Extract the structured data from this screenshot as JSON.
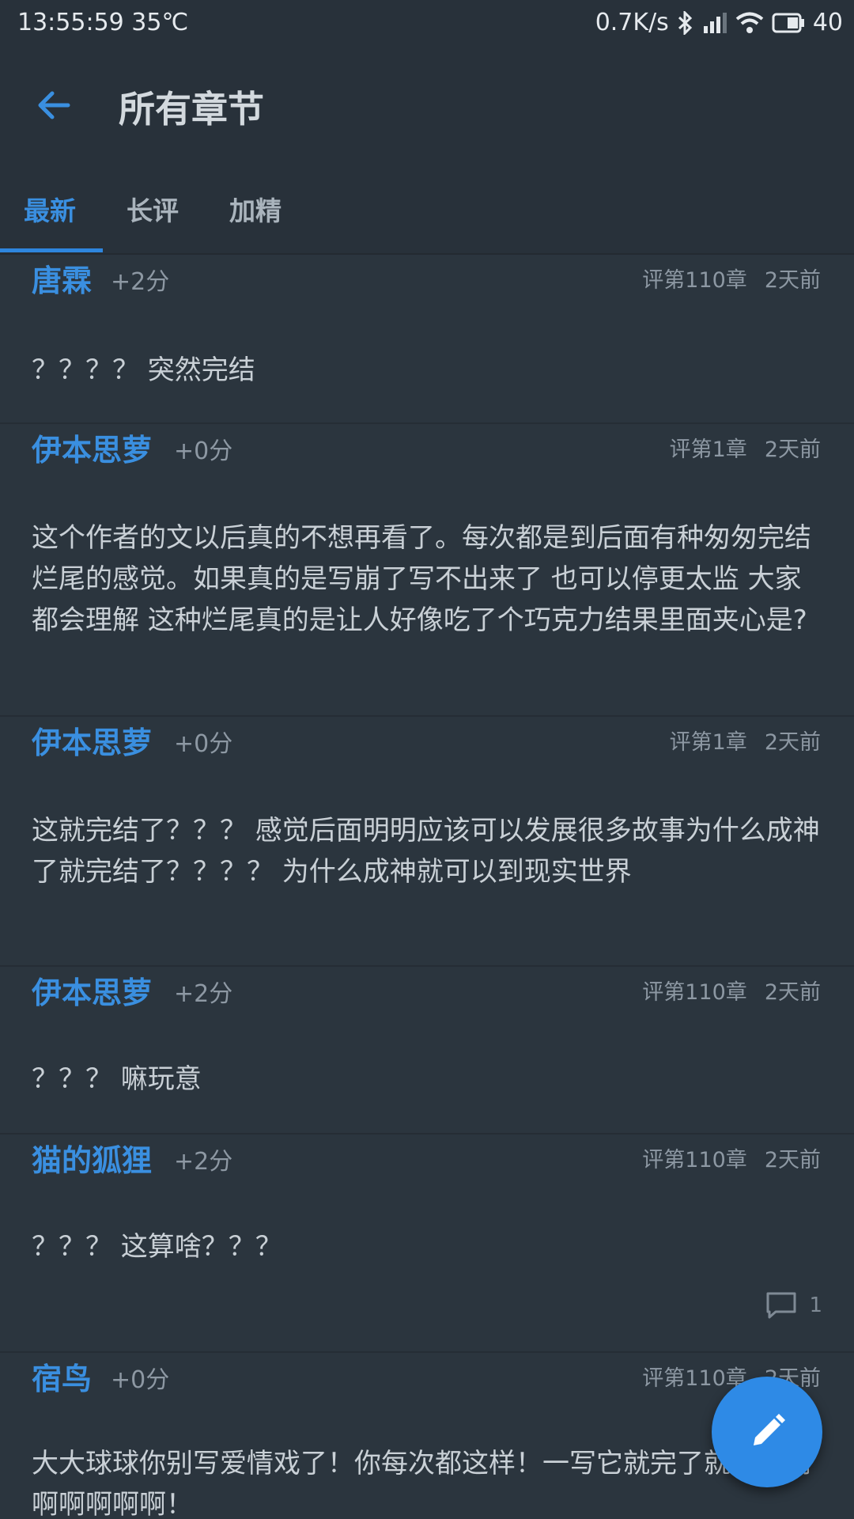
{
  "status": {
    "time_temp": "13:55:59 35℃",
    "net_speed": "0.7K/s",
    "battery": "40"
  },
  "appbar": {
    "title": "所有章节"
  },
  "tabs": [
    {
      "label": "最新",
      "active": true
    },
    {
      "label": "长评",
      "active": false
    },
    {
      "label": "加精",
      "active": false
    }
  ],
  "comments": [
    {
      "author": "唐霖",
      "score": "+2分",
      "chapter": "评第110章",
      "time": "2天前",
      "content": "？？？？ 突然完结"
    },
    {
      "author": "伊本思萝",
      "score": "+0分",
      "chapter": "评第1章",
      "time": "2天前",
      "content": "这个作者的文以后真的不想再看了。每次都是到后面有种匆匆完结烂尾的感觉。如果真的是写崩了写不出来了 也可以停更太监 大家都会理解 这种烂尾真的是让人好像吃了个巧克力结果里面夹心是?"
    },
    {
      "author": "伊本思萝",
      "score": "+0分",
      "chapter": "评第1章",
      "time": "2天前",
      "content": "这就完结了？？？ 感觉后面明明应该可以发展很多故事为什么成神了就完结了？？？？ 为什么成神就可以到现实世界"
    },
    {
      "author": "伊本思萝",
      "score": "+2分",
      "chapter": "评第110章",
      "time": "2天前",
      "content": "？？？ 嘛玩意"
    },
    {
      "author": "猫的狐狸",
      "score": "+2分",
      "chapter": "评第110章",
      "time": "2天前",
      "content": "？？？ 这算啥？？？",
      "replies": "1"
    },
    {
      "author": "宿鸟",
      "score": "+0分",
      "chapter": "评第110章",
      "time": "2天前",
      "content": "大大球球你别写爱情戏了！你每次都这样！一写它就完了就完了啊啊啊啊啊啊！"
    }
  ]
}
